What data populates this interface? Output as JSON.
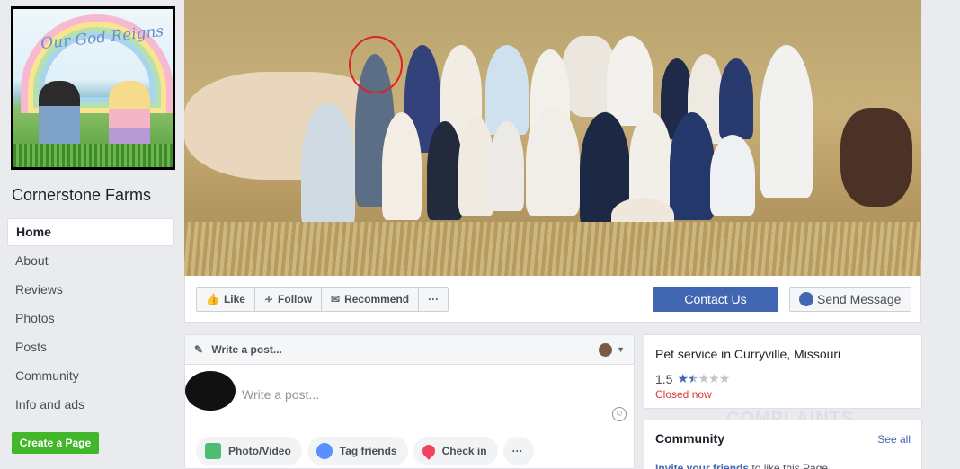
{
  "page": {
    "name": "Cornerstone Farms",
    "profile_art_text": "Our God Reigns"
  },
  "sidebar": {
    "items": [
      {
        "label": "Home",
        "active": true
      },
      {
        "label": "About"
      },
      {
        "label": "Reviews"
      },
      {
        "label": "Photos"
      },
      {
        "label": "Posts"
      },
      {
        "label": "Community"
      },
      {
        "label": "Info and ads"
      }
    ],
    "create_page_label": "Create a Page"
  },
  "action_bar": {
    "like": "Like",
    "follow": "Follow",
    "recommend": "Recommend",
    "more": "···",
    "contact_us": "Contact Us",
    "send_message": "Send Message"
  },
  "composer": {
    "header": "Write a post...",
    "placeholder": "Write a post...",
    "actions": {
      "photo_video": "Photo/Video",
      "tag_friends": "Tag friends",
      "check_in": "Check in",
      "more": "···"
    }
  },
  "info": {
    "category": "Pet service in Curryville, Missouri",
    "rating": "1.5",
    "stars_filled": 1.5,
    "stars_total": 5,
    "status": "Closed now"
  },
  "community": {
    "title": "Community",
    "see_all": "See all",
    "invite_link": "Invite your friends",
    "invite_rest": " to like this Page"
  },
  "watermark": "COMPLAINTS",
  "colors": {
    "brand_blue": "#4267b2",
    "green": "#42b72a",
    "closed_red": "#db3a3a",
    "background": "#e9ebee"
  }
}
